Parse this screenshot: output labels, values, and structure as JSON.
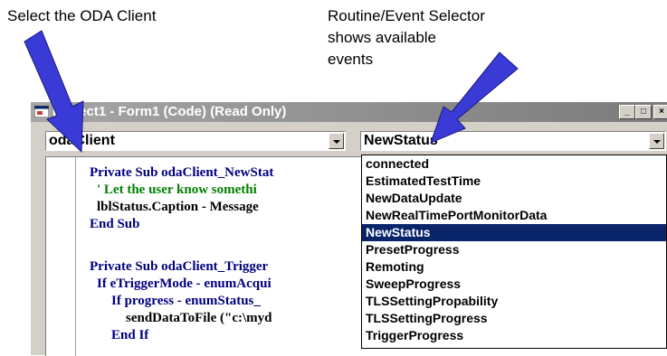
{
  "annotations": {
    "left": "Select the ODA Client",
    "right_lines": [
      "Routine/Event Selector",
      "shows available",
      "events"
    ]
  },
  "window": {
    "title": "Project1 - Form1 (Code) (Read Only)",
    "buttons": [
      "_",
      "□",
      "×"
    ]
  },
  "object_combo": {
    "value": "odaClient"
  },
  "procedure_combo": {
    "value": "NewStatus",
    "options": [
      "connected",
      "EstimatedTestTime",
      "NewDataUpdate",
      "NewRealTimePortMonitorData",
      "NewStatus",
      "PresetProgress",
      "Remoting",
      "SweepProgress",
      "TLSSettingPropability",
      "TLSSettingProgress",
      "TriggerProgress"
    ],
    "selected": "NewStatus"
  },
  "code_lines": [
    {
      "text": "Private Sub odaClient_NewStat",
      "kind": "keyword",
      "indent": 0
    },
    {
      "text": "' Let the user know somethi",
      "kind": "comment",
      "indent": 1
    },
    {
      "text": "lblStatus.Caption - Message",
      "kind": "text",
      "indent": 1
    },
    {
      "text": "End Sub",
      "kind": "keyword",
      "indent": 0
    },
    {
      "text": "Private Sub odaClient_Trigger",
      "kind": "keyword",
      "indent": 0
    },
    {
      "text": "If eTriggerMode - enumAcqui",
      "kind": "keyword",
      "indent": 1
    },
    {
      "text": "If progress - enumStatus_",
      "kind": "keyword",
      "indent": 2
    },
    {
      "text": "sendDataToFile (\"c:\\myd",
      "kind": "text",
      "indent": 3
    },
    {
      "text": "End If",
      "kind": "keyword",
      "indent": 2
    }
  ],
  "colors": {
    "keyword": "#000080",
    "comment": "#008000",
    "selection": "#0a246a",
    "arrow": "#3a3ad6"
  },
  "icons": [
    "vb-form-icon",
    "minimize-icon",
    "maximize-icon",
    "close-icon",
    "dropdown-arrow-icon",
    "callout-arrow-icon"
  ]
}
